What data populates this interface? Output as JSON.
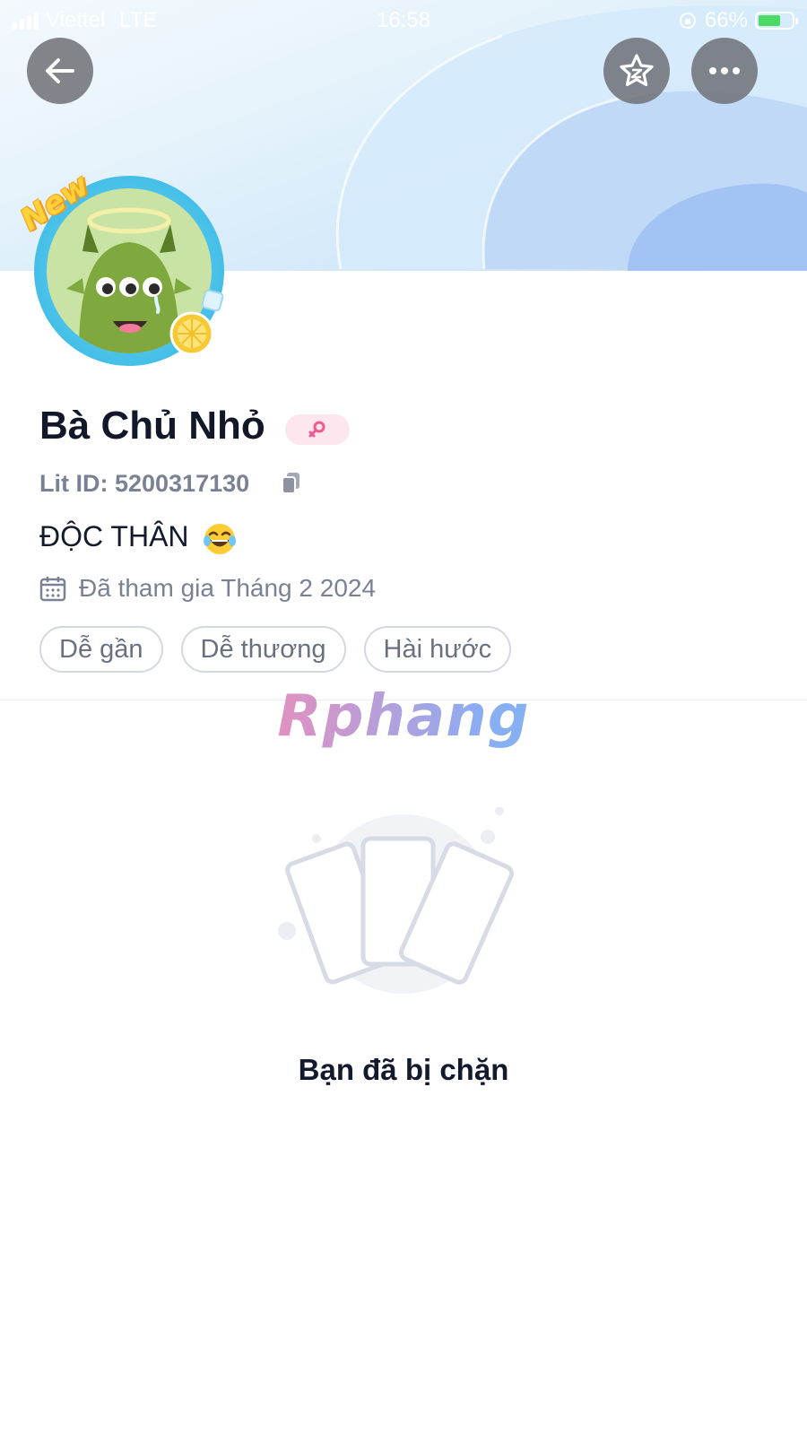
{
  "status_bar": {
    "carrier": "Viettel",
    "network": "LTE",
    "time": "16:58",
    "battery": "66%"
  },
  "header": {
    "back_icon": "arrow-left-icon",
    "favorite_icon": "star-icon",
    "more_icon": "ellipsis-icon"
  },
  "profile": {
    "avatar_badge": "New",
    "name": "Bà Chủ Nhỏ",
    "gender_icon": "female-icon",
    "lit_id": "Lit ID: 5200317130",
    "bio": "ĐỘC THÂN",
    "bio_emoji": "😂",
    "joined": "Đã tham gia Tháng 2 2024",
    "tags": [
      "Dễ gần",
      "Dễ thương",
      "Hài hước"
    ]
  },
  "watermark": "Rphang",
  "empty_state": {
    "message": "Bạn đã bị chặn"
  },
  "colors": {
    "text_primary": "#141a2e",
    "text_secondary": "#7b8194",
    "tag_border": "#d4d8e1",
    "gender_badge_bg": "#fde6ee",
    "gender_icon": "#f0598f",
    "header_button_bg": "#6e7076"
  }
}
